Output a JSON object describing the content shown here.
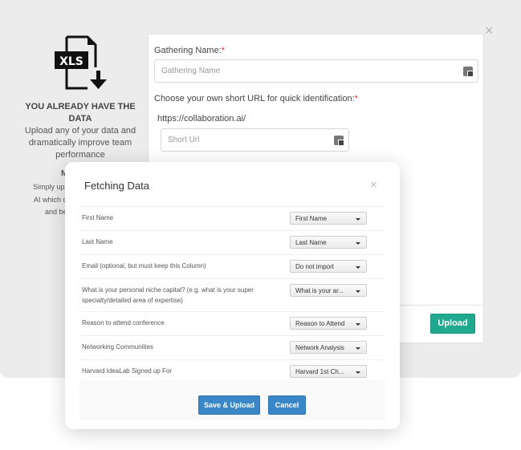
{
  "left_panel": {
    "icon": "xls-download-icon",
    "icon_text": "XLS",
    "heading": "YOU ALREADY HAVE THE DATA",
    "description": "Upload any of your data and dramatically improve team performance",
    "fragments": [
      "M",
      "Simply upl",
      "AI which q",
      "and be"
    ]
  },
  "form": {
    "gathering_label": "Gathering Name:",
    "gathering_placeholder": "Gathering Name",
    "url_label": "Choose your own short URL for quick identification:",
    "url_prefix": "https://collaboration.ai/",
    "url_placeholder": "Short Url",
    "required_mark": "*",
    "upload_label": "Upload",
    "close": "×"
  },
  "modal": {
    "title": "Fetching Data",
    "close": "×",
    "rows": [
      {
        "label": "First Name",
        "value": "First Name"
      },
      {
        "label": "Last Name",
        "value": "Last Name"
      },
      {
        "label": "Email (optional, but must keep this Column)",
        "value": "Do not import"
      },
      {
        "label": "What is your personal niche capital? (e.g. what is your super specialty/detailed area of expertise)",
        "value": "What is your ar..."
      },
      {
        "label": "Reason to attend conference",
        "value": "Reason to Attend"
      },
      {
        "label": "Networking Communities",
        "value": "Network Analysis"
      },
      {
        "label": "Harvard IdeaLab Signed up For",
        "value": "Harvard 1st Ch..."
      }
    ],
    "save_label": "Save & Upload",
    "cancel_label": "Cancel"
  },
  "colors": {
    "upload": "#20a98f",
    "primary": "#3a87c8",
    "required": "#dd3333"
  }
}
